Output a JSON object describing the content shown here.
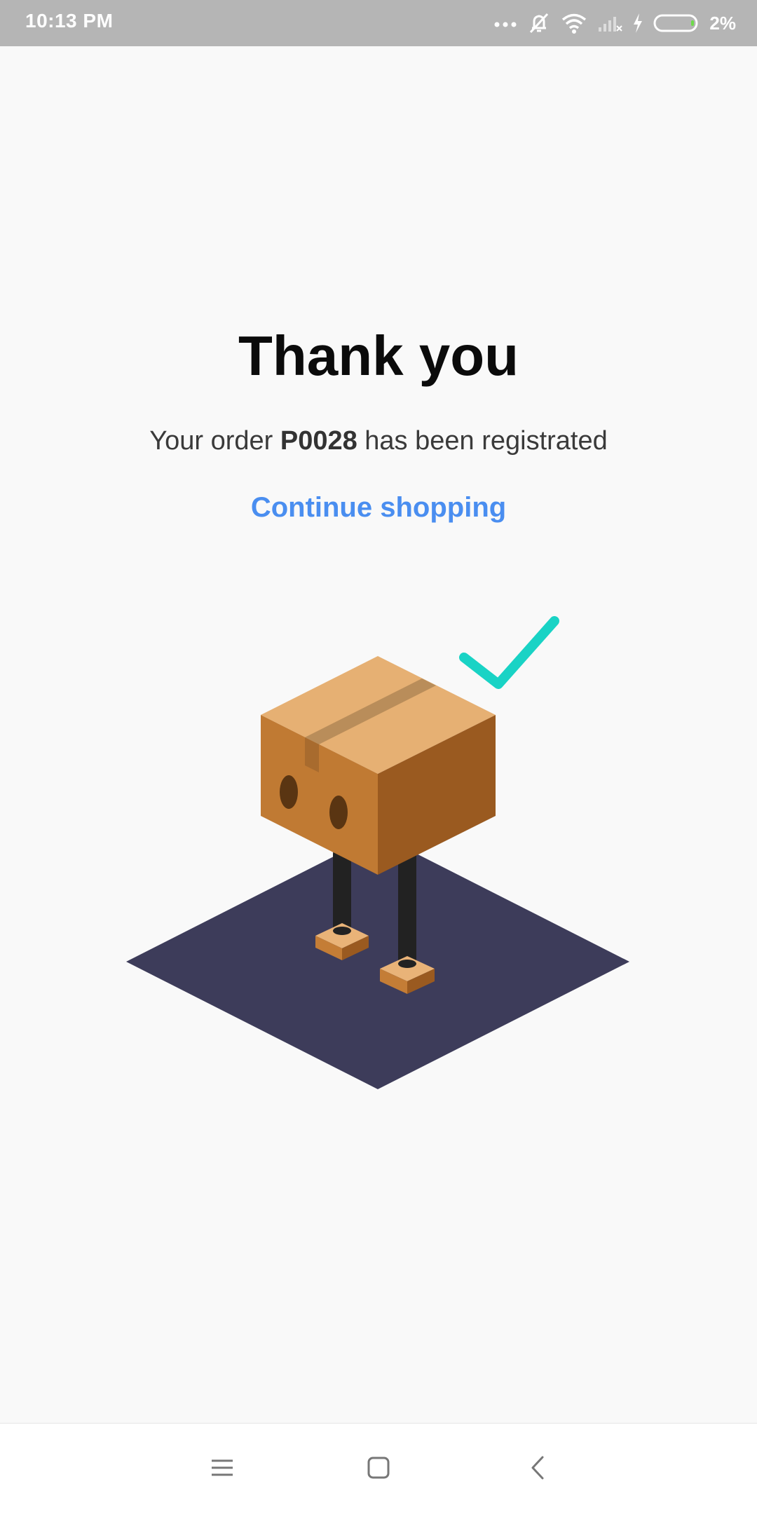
{
  "status_bar": {
    "time": "10:13 PM",
    "battery": "2%",
    "icons": [
      "more-dots-icon",
      "alarm-off-icon",
      "wifi-icon",
      "signal-no-service-icon",
      "charging-icon",
      "battery-icon"
    ]
  },
  "main": {
    "title": "Thank you",
    "message_prefix": "Your order ",
    "order_code": "P0028",
    "message_suffix": " has been registrated",
    "continue_label": "Continue shopping"
  },
  "illustration": {
    "name": "box-robot-illustration",
    "colors": {
      "floor": "#3d3c5a",
      "box_top": "#e6b073",
      "box_left": "#c07a33",
      "box_right": "#9a5a20",
      "tape": "#b98d5a",
      "eyes": "#5a3512",
      "legs": "#222222",
      "check": "#19d3c5"
    }
  },
  "nav_bar": {
    "buttons": [
      "menu-icon",
      "home-icon",
      "back-icon"
    ]
  },
  "colors": {
    "accent_link": "#4a8ef0",
    "background": "#f9f9f9",
    "status_bar": "#b5b5b5"
  }
}
